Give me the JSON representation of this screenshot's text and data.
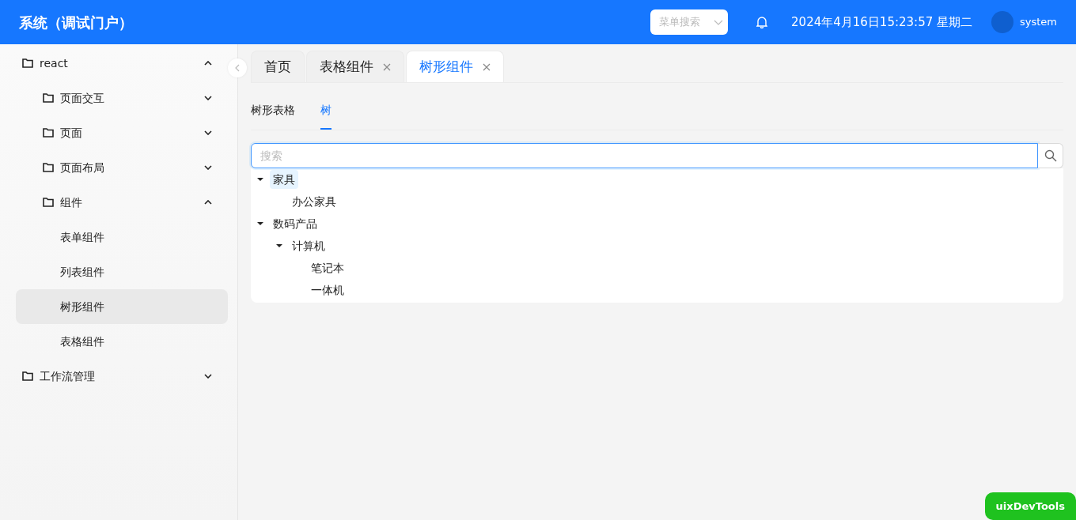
{
  "header": {
    "title": "系统（调试门户）",
    "menu_search": {
      "placeholder": "菜单搜索"
    },
    "datetime": "2024年4月16日15:23:57 星期二",
    "user": "system"
  },
  "sidebar": {
    "items": [
      {
        "label": "react",
        "kind": "folder",
        "expanded": true,
        "children": [
          {
            "label": "页面交互",
            "kind": "folder",
            "expanded": false
          },
          {
            "label": "页面",
            "kind": "folder",
            "expanded": false
          },
          {
            "label": "页面布局",
            "kind": "folder",
            "expanded": false
          },
          {
            "label": "组件",
            "kind": "folder",
            "expanded": true,
            "children": [
              {
                "label": "表单组件",
                "selected": false
              },
              {
                "label": "列表组件",
                "selected": false
              },
              {
                "label": "树形组件",
                "selected": true
              },
              {
                "label": "表格组件",
                "selected": false
              }
            ]
          }
        ]
      },
      {
        "label": "工作流管理",
        "kind": "folder",
        "expanded": false
      }
    ]
  },
  "tabs": [
    {
      "label": "首页",
      "selected": false,
      "closable": false
    },
    {
      "label": "表格组件",
      "selected": false,
      "closable": true
    },
    {
      "label": "树形组件",
      "selected": true,
      "closable": true
    }
  ],
  "subtabs": [
    {
      "label": "树形表格",
      "selected": false
    },
    {
      "label": "树",
      "selected": true
    }
  ],
  "tree_search": {
    "placeholder": "搜索"
  },
  "tree": [
    {
      "label": "家具",
      "expanded": true,
      "selected": true,
      "children": [
        {
          "label": "办公家具",
          "selected": false
        }
      ]
    },
    {
      "label": "数码产品",
      "expanded": true,
      "selected": false,
      "children": [
        {
          "label": "计算机",
          "expanded": true,
          "selected": false,
          "children": [
            {
              "label": "笔记本",
              "selected": false
            },
            {
              "label": "一体机",
              "selected": false
            }
          ]
        }
      ]
    }
  ],
  "devtools_button": "uixDevTools"
}
